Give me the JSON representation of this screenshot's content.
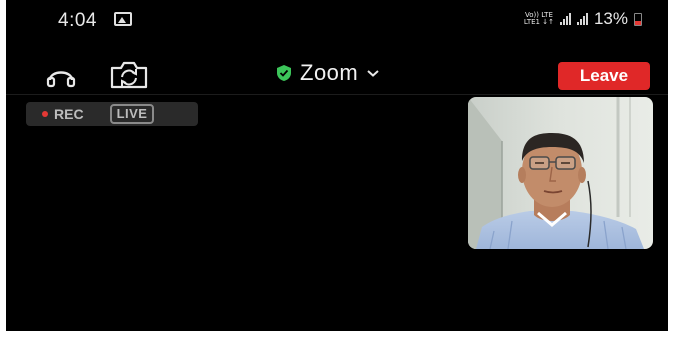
{
  "status_bar": {
    "time": "4:04",
    "network_line1": "Vo)) LTE",
    "network_line2": "LTE1 ↓↑",
    "battery": "13%",
    "icons": [
      "gallery-icon",
      "signal-icon",
      "signal-icon",
      "battery-icon"
    ]
  },
  "toolbar": {
    "audio_icon": "headset-icon",
    "camera_switch_icon": "camera-switch-icon",
    "title": "Zoom",
    "security_icon": "shield-check-icon",
    "title_dropdown_icon": "chevron-down-icon",
    "leave_label": "Leave",
    "leave_color": "#e02828"
  },
  "recording": {
    "rec_label": "REC",
    "live_label": "LIVE"
  },
  "video": {
    "self_view": "participant-video",
    "background": "#000000"
  }
}
